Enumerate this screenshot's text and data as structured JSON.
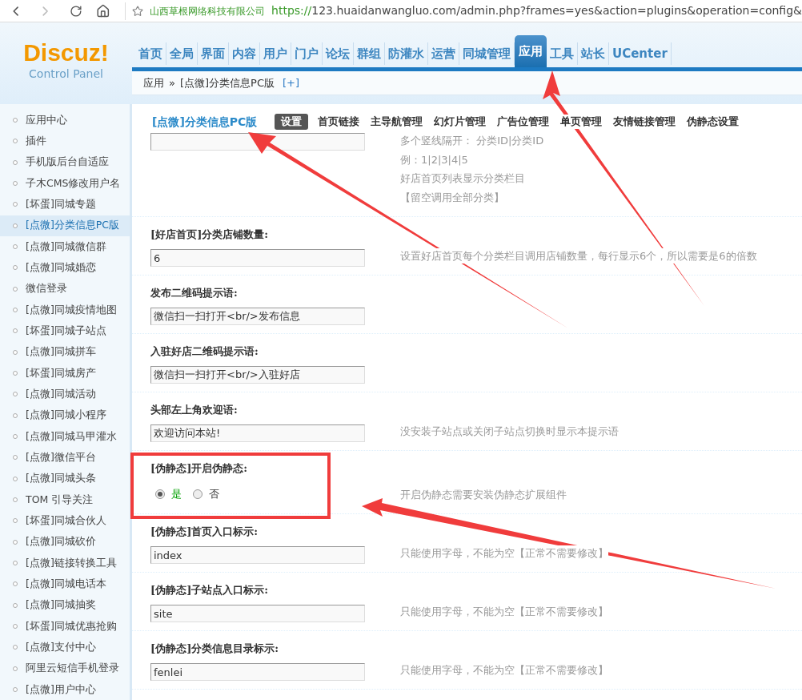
{
  "browser": {
    "site_name": "山西草根网络科技有限公司",
    "url_scheme": "https://",
    "url_rest": "123.huaidanwangluo.com/admin.php?frames=yes&action=plugins&operation=config&"
  },
  "logo": {
    "brand": "Discuz!",
    "subtitle": "Control Panel"
  },
  "nav": [
    {
      "label": "首页",
      "selected": false
    },
    {
      "label": "全局",
      "selected": false
    },
    {
      "label": "界面",
      "selected": false
    },
    {
      "label": "内容",
      "selected": false
    },
    {
      "label": "用户",
      "selected": false
    },
    {
      "label": "门户",
      "selected": false
    },
    {
      "label": "论坛",
      "selected": false
    },
    {
      "label": "群组",
      "selected": false
    },
    {
      "label": "防灌水",
      "selected": false
    },
    {
      "label": "运营",
      "selected": false
    },
    {
      "label": "同城管理",
      "selected": false
    },
    {
      "label": "应用",
      "selected": true
    },
    {
      "label": "工具",
      "selected": false
    },
    {
      "label": "站长",
      "selected": false
    },
    {
      "label": "UCenter",
      "selected": false
    }
  ],
  "breadcrumb": {
    "root": "应用",
    "separator": "»",
    "current": "[点微]分类信息PC版",
    "add": "[+]"
  },
  "sidebar": [
    {
      "label": "应用中心",
      "selected": false
    },
    {
      "label": "插件",
      "selected": false
    },
    {
      "label": "手机版后台自适应",
      "selected": false
    },
    {
      "label": "子木CMS修改用户名",
      "selected": false
    },
    {
      "label": "[坏蛋]同城专题",
      "selected": false
    },
    {
      "label": "[点微]分类信息PC版",
      "selected": true
    },
    {
      "label": "[点微]同城微信群",
      "selected": false
    },
    {
      "label": "[点微]同城婚恋",
      "selected": false
    },
    {
      "label": "微信登录",
      "selected": false
    },
    {
      "label": "[点微]同城疫情地图",
      "selected": false
    },
    {
      "label": "[坏蛋]同城子站点",
      "selected": false
    },
    {
      "label": "[点微]同城拼车",
      "selected": false
    },
    {
      "label": "[坏蛋]同城房产",
      "selected": false
    },
    {
      "label": "[点微]同城活动",
      "selected": false
    },
    {
      "label": "[点微]同城小程序",
      "selected": false
    },
    {
      "label": "[点微]同城马甲灌水",
      "selected": false
    },
    {
      "label": "[点微]微信平台",
      "selected": false
    },
    {
      "label": "[点微]同城头条",
      "selected": false
    },
    {
      "label": "TOM 引导关注",
      "selected": false
    },
    {
      "label": "[坏蛋]同城合伙人",
      "selected": false
    },
    {
      "label": "[点微]同城砍价",
      "selected": false
    },
    {
      "label": "[点微]链接转换工具",
      "selected": false
    },
    {
      "label": "[点微]同城电话本",
      "selected": false
    },
    {
      "label": "[点微]同城抽奖",
      "selected": false
    },
    {
      "label": "[坏蛋]同城优惠抢购",
      "selected": false
    },
    {
      "label": "[点微]支付中心",
      "selected": false
    },
    {
      "label": "阿里云短信手机登录",
      "selected": false
    },
    {
      "label": "[点微]用户中心",
      "selected": false
    }
  ],
  "plugin_title": "[点微]分类信息PC版",
  "tabs": [
    {
      "label": "设置",
      "selected": true
    },
    {
      "label": "首页链接",
      "selected": false
    },
    {
      "label": "主导航管理",
      "selected": false
    },
    {
      "label": "幻灯片管理",
      "selected": false
    },
    {
      "label": "广告位管理",
      "selected": false
    },
    {
      "label": "单页管理",
      "selected": false
    },
    {
      "label": "友情链接管理",
      "selected": false
    },
    {
      "label": "伪静态设置",
      "selected": false
    }
  ],
  "settings": [
    {
      "kind": "text",
      "hints": [
        "多个竖线隔开： 分类ID|分类ID",
        "例：1|2|3|4|5",
        "好店首页列表显示分类栏目",
        "【留空调用全部分类】"
      ]
    },
    {
      "kind": "text",
      "label": "[好店首页]分类店铺数量:",
      "value": "6",
      "hints": [
        "设置好店首页每个分类栏目调用店铺数量，每行显示6个，所以需要是6的倍数"
      ]
    },
    {
      "kind": "text",
      "label": "发布二维码提示语:",
      "value": "微信扫一扫打开<br/>发布信息"
    },
    {
      "kind": "text",
      "label": "入驻好店二维码提示语:",
      "value": "微信扫一扫打开<br/>入驻好店"
    },
    {
      "kind": "text",
      "label": "头部左上角欢迎语:",
      "value": "欢迎访问本站!",
      "hints": [
        "没安装子站点或关闭子站点切换时显示本提示语"
      ]
    },
    {
      "kind": "radio",
      "label": "[伪静态]开启伪静态:",
      "options": [
        {
          "label": "是",
          "selected": true
        },
        {
          "label": "否",
          "selected": false
        }
      ],
      "hints": [
        "开启伪静态需要安装伪静态扩展组件"
      ]
    },
    {
      "kind": "text",
      "label": "[伪静态]首页入口标示:",
      "value": "index",
      "hints": [
        "只能使用字母，不能为空【正常不需要修改】"
      ]
    },
    {
      "kind": "text",
      "label": "[伪静态]子站点入口标示:",
      "value": "site",
      "hints": [
        "只能使用字母，不能为空【正常不需要修改】"
      ]
    },
    {
      "kind": "text",
      "label": "[伪静态]分类信息目录标示:",
      "value": "fenlei",
      "hints": [
        "只能使用字母，不能为空【正常不需要修改】"
      ]
    }
  ]
}
